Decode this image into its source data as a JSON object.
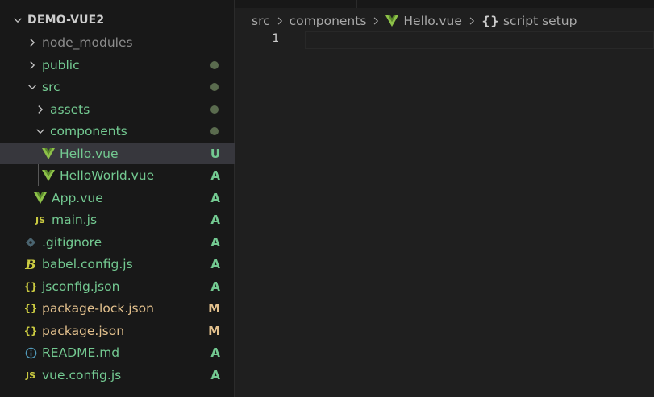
{
  "explorer": {
    "root": "DEMO-VUE2",
    "items": [
      {
        "name": "node_modules",
        "status": "",
        "dot": false
      },
      {
        "name": "public",
        "status": "",
        "dot": true
      },
      {
        "name": "src",
        "status": "",
        "dot": true
      },
      {
        "name": "assets",
        "status": "",
        "dot": true
      },
      {
        "name": "components",
        "status": "",
        "dot": true
      },
      {
        "name": "Hello.vue",
        "status": "U",
        "dot": false
      },
      {
        "name": "HelloWorld.vue",
        "status": "A",
        "dot": false
      },
      {
        "name": "App.vue",
        "status": "A",
        "dot": false
      },
      {
        "name": "main.js",
        "status": "A",
        "dot": false
      },
      {
        "name": ".gitignore",
        "status": "A",
        "dot": false
      },
      {
        "name": "babel.config.js",
        "status": "A",
        "dot": false
      },
      {
        "name": "jsconfig.json",
        "status": "A",
        "dot": false
      },
      {
        "name": "package-lock.json",
        "status": "M",
        "dot": false
      },
      {
        "name": "package.json",
        "status": "M",
        "dot": false
      },
      {
        "name": "README.md",
        "status": "A",
        "dot": false
      },
      {
        "name": "vue.config.js",
        "status": "A",
        "dot": false
      }
    ]
  },
  "icons": {
    "js": "JS",
    "json": "{}",
    "babel": "B",
    "info": "i"
  },
  "breadcrumb": {
    "src": "src",
    "components": "components",
    "file": "Hello.vue",
    "symbol_icon": "{}",
    "symbol": "script setup"
  },
  "editor": {
    "line_number": "1"
  },
  "colors": {
    "untracked": "#73c991",
    "added": "#73c991",
    "modified": "#e2c08d",
    "vue": "#8dc149",
    "js": "#cbcb41",
    "json": "#cbcb41",
    "git": "#41535b",
    "info": "#519aba"
  }
}
